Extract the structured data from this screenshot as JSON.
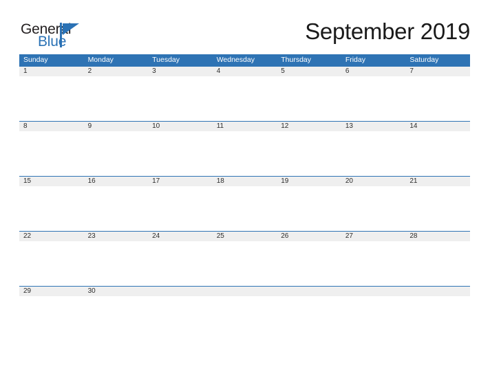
{
  "brand": {
    "name_part1": "General",
    "name_part2": "Blue",
    "accent_color": "#2b72b5",
    "text_color": "#231f20"
  },
  "header": {
    "title": "September 2019"
  },
  "calendar": {
    "month": "September",
    "year": "2019",
    "header_bg": "#2e73b4",
    "header_text_color": "#ffffff",
    "date_band_bg": "#efefef",
    "rule_color": "#2e73b4",
    "weekdays": [
      "Sunday",
      "Monday",
      "Tuesday",
      "Wednesday",
      "Thursday",
      "Friday",
      "Saturday"
    ],
    "weeks": [
      {
        "days": [
          {
            "date": "1"
          },
          {
            "date": "2"
          },
          {
            "date": "3"
          },
          {
            "date": "4"
          },
          {
            "date": "5"
          },
          {
            "date": "6"
          },
          {
            "date": "7"
          }
        ]
      },
      {
        "days": [
          {
            "date": "8"
          },
          {
            "date": "9"
          },
          {
            "date": "10"
          },
          {
            "date": "11"
          },
          {
            "date": "12"
          },
          {
            "date": "13"
          },
          {
            "date": "14"
          }
        ]
      },
      {
        "days": [
          {
            "date": "15"
          },
          {
            "date": "16"
          },
          {
            "date": "17"
          },
          {
            "date": "18"
          },
          {
            "date": "19"
          },
          {
            "date": "20"
          },
          {
            "date": "21"
          }
        ]
      },
      {
        "days": [
          {
            "date": "22"
          },
          {
            "date": "23"
          },
          {
            "date": "24"
          },
          {
            "date": "25"
          },
          {
            "date": "26"
          },
          {
            "date": "27"
          },
          {
            "date": "28"
          }
        ]
      },
      {
        "days": [
          {
            "date": "29"
          },
          {
            "date": "30"
          },
          {
            "date": ""
          },
          {
            "date": ""
          },
          {
            "date": ""
          },
          {
            "date": ""
          },
          {
            "date": ""
          }
        ]
      }
    ]
  }
}
